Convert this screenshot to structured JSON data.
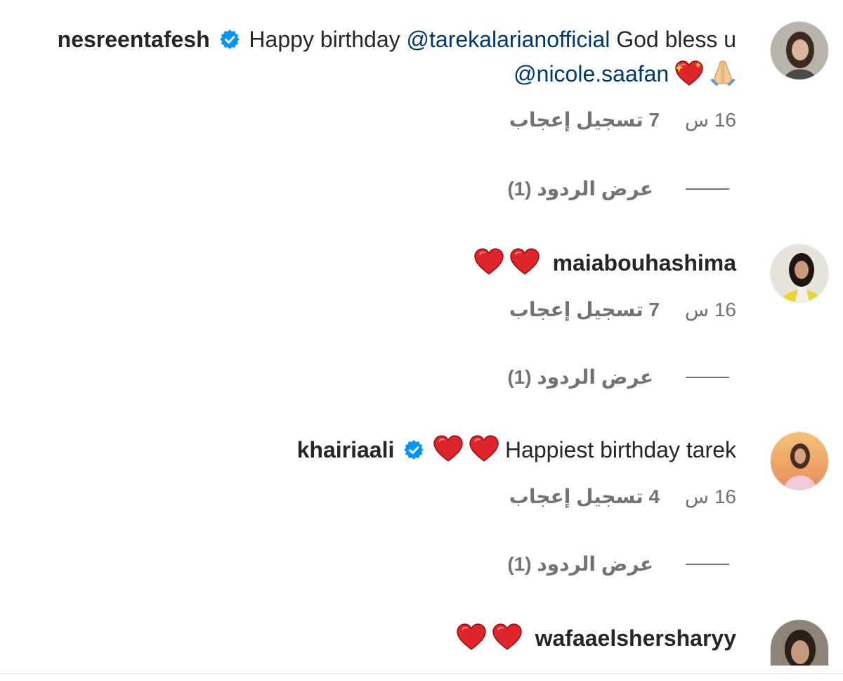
{
  "comments": [
    {
      "username": "nesreentafesh",
      "verified": true,
      "text_before_mention1": "Happy birthday ",
      "mention1": "@tarekalarianofficial",
      "text_middle": " God bless u ",
      "mention2": "@nicole.saafan",
      "emojis": [
        "sparkling-heart",
        "folded-hands"
      ],
      "time": "16 س",
      "likes": "7 تسجيل إعجاب",
      "replies_label": "عرض الردود (1)"
    },
    {
      "username": "maiabouhashima",
      "verified": false,
      "text": "",
      "emojis": [
        "red-heart",
        "red-heart"
      ],
      "time": "16 س",
      "likes": "7 تسجيل إعجاب",
      "replies_label": "عرض الردود (1)"
    },
    {
      "username": "khairiaali",
      "verified": true,
      "text": "Happiest birthday tarek",
      "emojis": [
        "red-heart",
        "red-heart"
      ],
      "time": "16 س",
      "likes": "4 تسجيل إعجاب",
      "replies_label": "عرض الردود (1)"
    },
    {
      "username": "wafaaelshersharyy",
      "verified": false,
      "text": "",
      "emojis": [
        "red-heart",
        "red-heart"
      ]
    }
  ],
  "colors": {
    "text": "#262626",
    "secondary": "#737373",
    "mention": "#00376b",
    "verified": "#0095f6",
    "heart": "#e0242b"
  }
}
